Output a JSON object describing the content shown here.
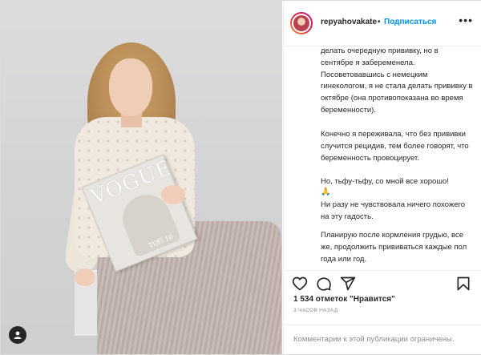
{
  "post": {
    "username": "repyahovakate",
    "separator": "•",
    "follow_label": "Подписаться",
    "more_label": "•••",
    "caption": {
      "p1": "делать очередную прививку, но в сентябре я забеременела. Посоветовавшись с немецким гинекологом, я не стала делать прививку в октябре (она противопоказана во время беременности).",
      "p2": "Конечно я переживала, что без прививки случится рецидив, тем более говорят, что беременность провоцирует.",
      "p3": "Но, тьфу-тьфу, со мной все хорошо!",
      "p3_emoji": "🙏",
      "p4": "Ни разу не чувствовала ничего похожего на эту гадость.",
      "p5": "Планирую после кормления грудью, все же, продолжить прививаться каждые пол года или год."
    },
    "likes": "1 534 отметок \"Нравится\"",
    "time": "3 ЧАСОВ НАЗАД",
    "comments_disabled": "Комментарии к этой публикации ограничены."
  },
  "photo": {
    "magazine_title": "VOGUE",
    "magazine_sub": "ТОП 10"
  },
  "icons": [
    "heart-icon",
    "comment-icon",
    "share-icon",
    "bookmark-icon",
    "user-icon"
  ],
  "colors": {
    "accent": "#0095f6",
    "text": "#262626",
    "muted": "#8e8e8e",
    "border": "#efefef"
  }
}
